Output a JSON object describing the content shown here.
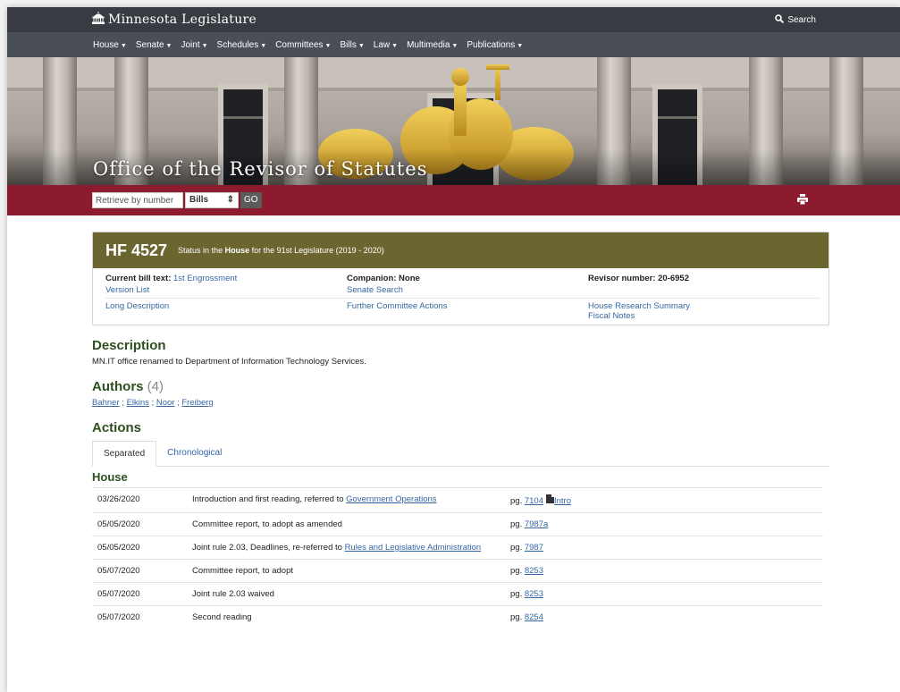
{
  "header": {
    "site_title": "Minnesota Legislature",
    "search_label": "Search"
  },
  "nav": {
    "items": [
      "House",
      "Senate",
      "Joint",
      "Schedules",
      "Committees",
      "Bills",
      "Law",
      "Multimedia",
      "Publications"
    ]
  },
  "hero": {
    "title": "Office of the Revisor of Statutes"
  },
  "retrieve": {
    "placeholder": "Retrieve by number",
    "select_value": "Bills",
    "go_label": "GO"
  },
  "bill": {
    "number": "HF 4527",
    "status_prefix": "Status in the ",
    "status_chamber": "House",
    "status_suffix": " for the 91st Legislature (2019 - 2020)",
    "current_text_label": "Current bill text: ",
    "current_text_link": "1st Engrossment",
    "companion": "Companion: None",
    "revisor": "Revisor number: 20-6952",
    "version_list": "Version List",
    "senate_search": "Senate Search",
    "long_description": "Long Description",
    "further_actions": "Further Committee Actions",
    "research_summary": "House Research Summary",
    "fiscal_notes": "Fiscal Notes"
  },
  "description": {
    "heading": "Description",
    "text": "MN.IT office renamed to Department of Information Technology Services."
  },
  "authors": {
    "heading": "Authors",
    "count": "(4)",
    "names": [
      "Bahner",
      "Elkins",
      "Noor",
      "Freiberg"
    ]
  },
  "actions": {
    "heading": "Actions",
    "tabs": [
      "Separated",
      "Chronological"
    ],
    "chamber": "House",
    "rows": [
      {
        "date": "03/26/2020",
        "text": "Introduction and first reading, referred to ",
        "link": "Government Operations",
        "pg_prefix": "pg. ",
        "pg": "7104",
        "extra": "Intro"
      },
      {
        "date": "05/05/2020",
        "text": "Committee report, to adopt as amended",
        "link": "",
        "pg_prefix": "pg. ",
        "pg": "7987a",
        "extra": ""
      },
      {
        "date": "05/05/2020",
        "text": "Joint rule 2.03, Deadlines, re-referred to ",
        "link": "Rules and Legislative Administration",
        "pg_prefix": "pg. ",
        "pg": "7987",
        "extra": ""
      },
      {
        "date": "05/07/2020",
        "text": "Committee report, to adopt",
        "link": "",
        "pg_prefix": "pg. ",
        "pg": "8253",
        "extra": ""
      },
      {
        "date": "05/07/2020",
        "text": "Joint rule 2.03 waived",
        "link": "",
        "pg_prefix": "pg. ",
        "pg": "8253",
        "extra": ""
      },
      {
        "date": "05/07/2020",
        "text": "Second reading",
        "link": "",
        "pg_prefix": "pg. ",
        "pg": "8254",
        "extra": ""
      }
    ]
  }
}
